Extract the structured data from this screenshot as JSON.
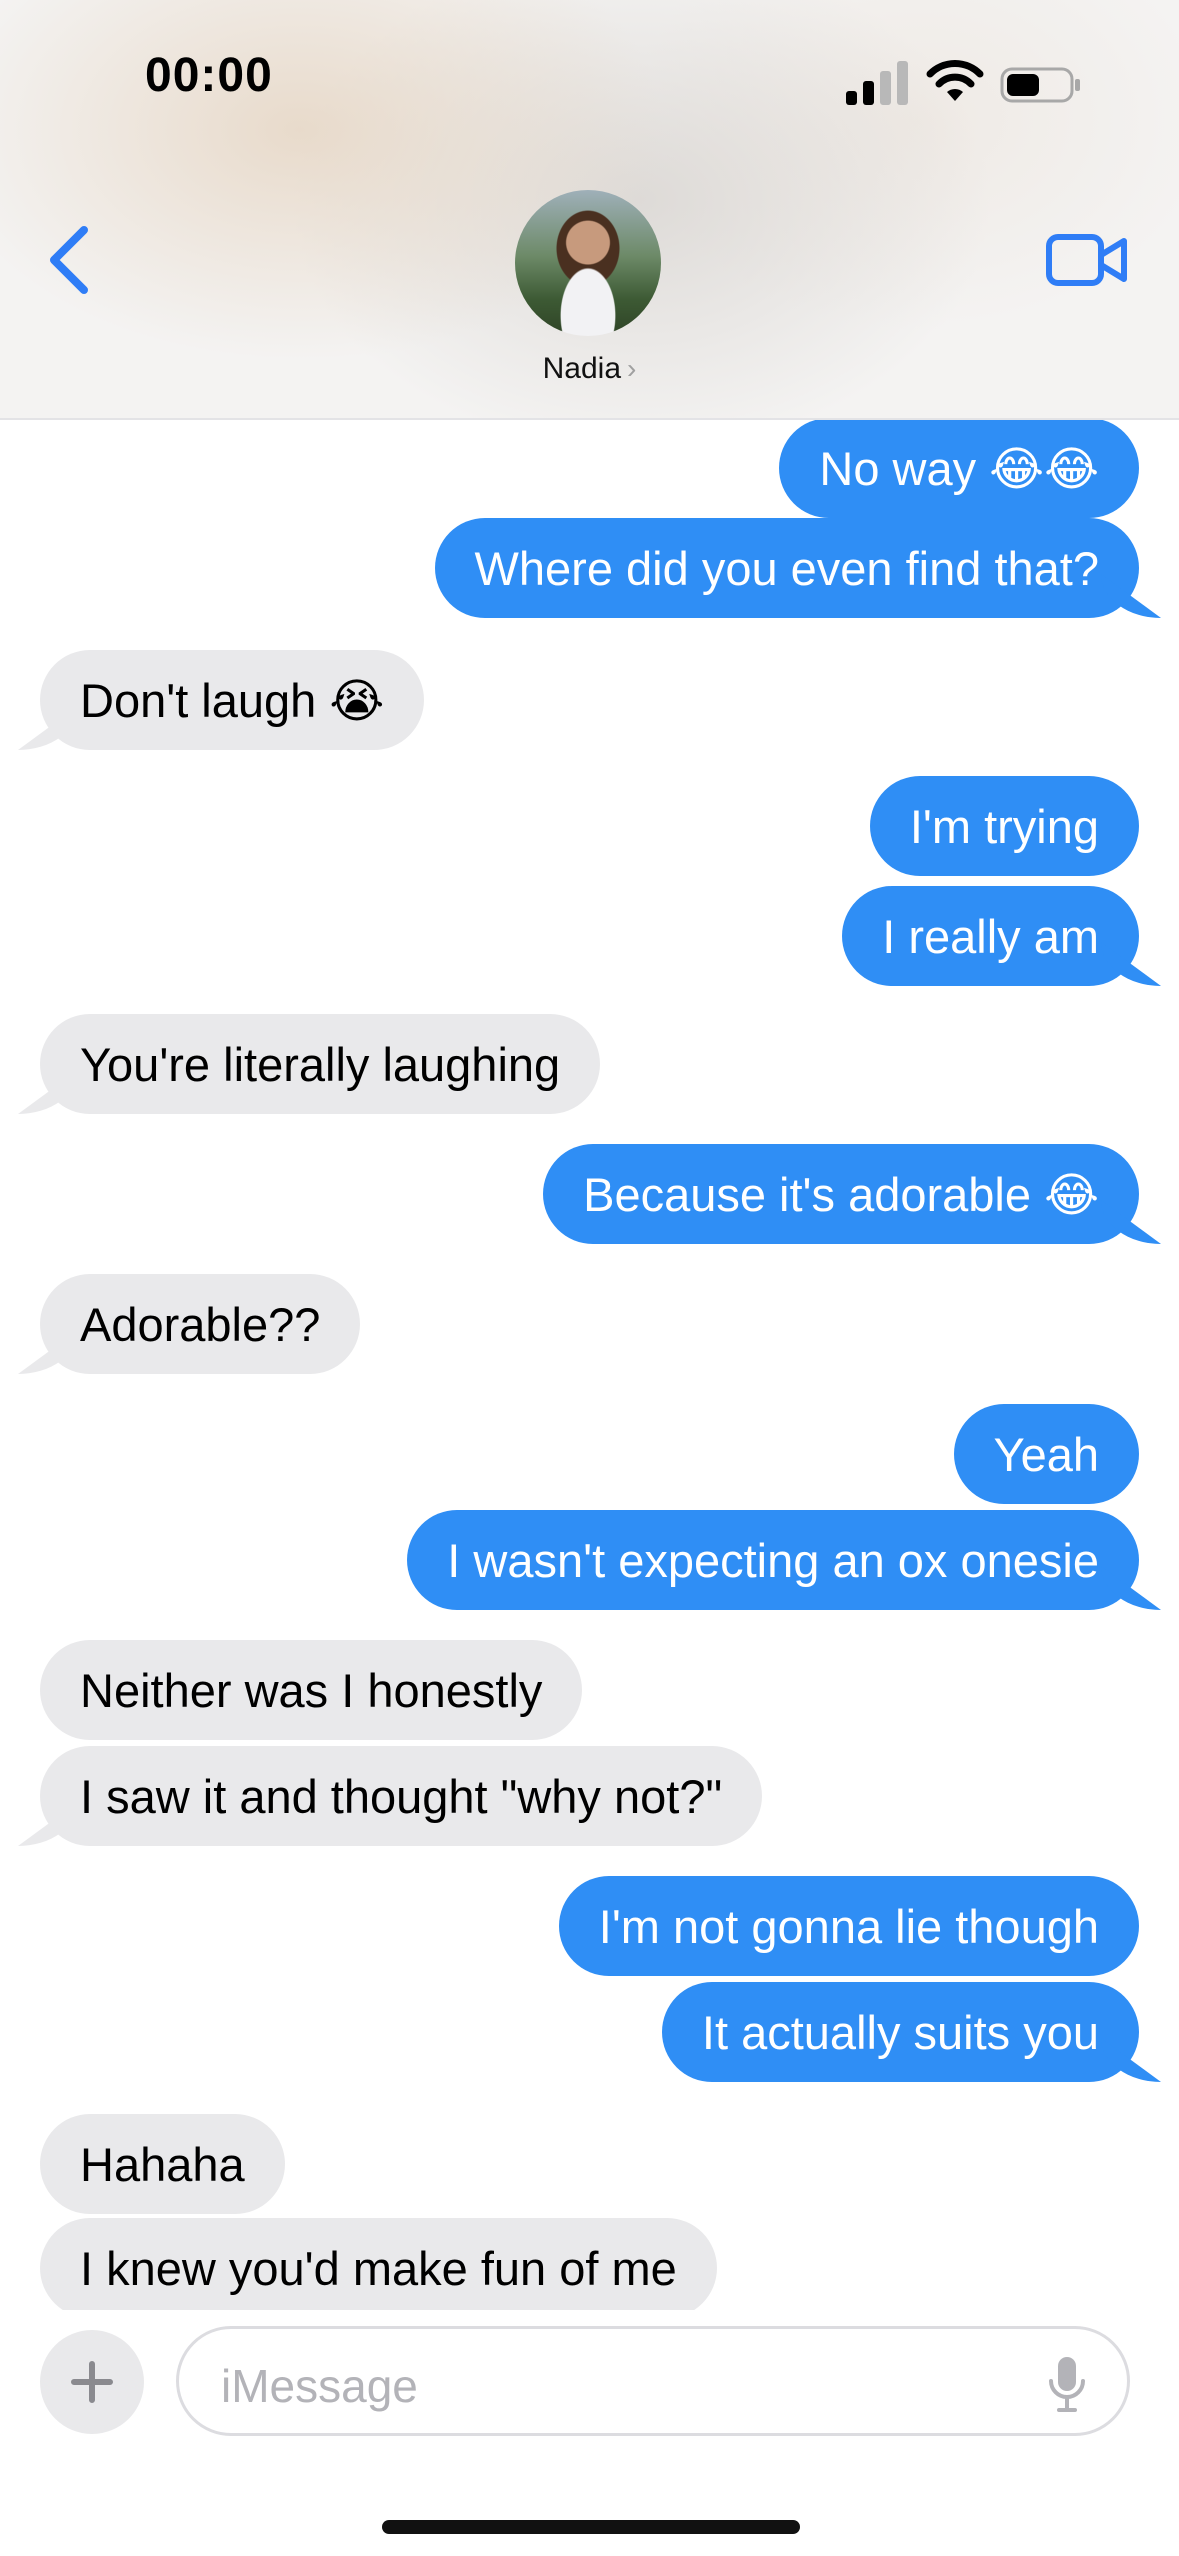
{
  "status_bar": {
    "time": "00:00"
  },
  "contact": {
    "name": "Nadia",
    "chevron": "›"
  },
  "messages": [
    {
      "from": "me",
      "text": "No way 😂😂"
    },
    {
      "from": "me",
      "text": "Where did you even find that?"
    },
    {
      "from": "them",
      "text": "Don't laugh 😭"
    },
    {
      "from": "me",
      "text": "I'm trying"
    },
    {
      "from": "me",
      "text": "I really am"
    },
    {
      "from": "them",
      "text": "You're literally laughing"
    },
    {
      "from": "me",
      "text": "Because it's adorable 😂"
    },
    {
      "from": "them",
      "text": "Adorable??"
    },
    {
      "from": "me",
      "text": "Yeah"
    },
    {
      "from": "me",
      "text": "I wasn't expecting an ox onesie"
    },
    {
      "from": "them",
      "text": "Neither was I honestly"
    },
    {
      "from": "them",
      "text": "I saw it and thought \"why not?\""
    },
    {
      "from": "me",
      "text": "I'm not gonna lie though"
    },
    {
      "from": "me",
      "text": "It actually suits you"
    },
    {
      "from": "them",
      "text": "Hahaha"
    },
    {
      "from": "them",
      "text": "I knew you'd make fun of me"
    }
  ],
  "composer": {
    "placeholder": "iMessage"
  },
  "colors": {
    "sent_bubble": "#2f8ef5",
    "received_bubble": "#e9e9eb",
    "accent": "#2f7df6"
  },
  "icons": [
    "back-chevron-icon",
    "video-camera-icon",
    "plus-icon",
    "microphone-icon",
    "signal-icon",
    "wifi-icon",
    "battery-icon"
  ]
}
